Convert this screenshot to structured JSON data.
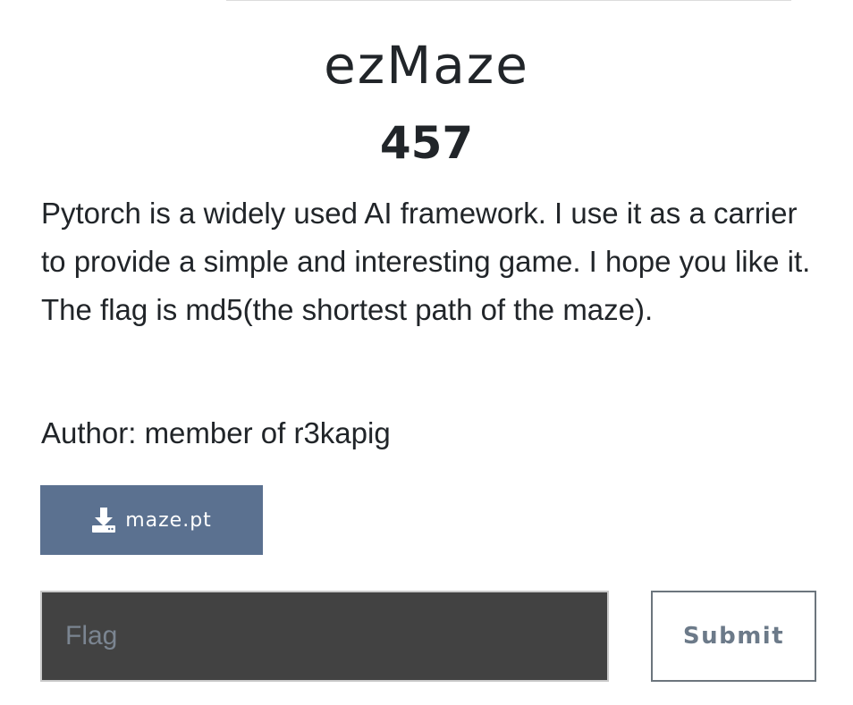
{
  "challenge": {
    "title": "ezMaze",
    "points": "457",
    "description": "Pytorch is a widely used AI framework. I use it as a carrier to provide a simple and interesting game. I hope you like it. The flag is md5(the shortest path of the maze).",
    "author": "Author: member of r3kapig"
  },
  "attachment": {
    "label": "maze.pt",
    "icon": "download-icon"
  },
  "flag_form": {
    "input_value": "",
    "input_placeholder": "Flag",
    "submit_label": "Submit"
  },
  "colors": {
    "download_button_bg": "#5b7190",
    "flag_input_bg": "#424242",
    "submit_text": "#6c7a89"
  }
}
